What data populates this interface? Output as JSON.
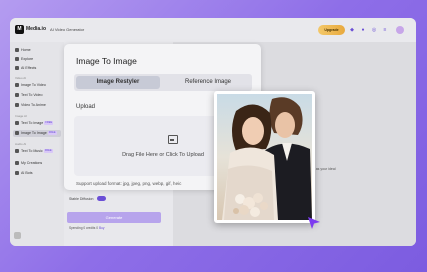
{
  "topbar": {
    "brand": "Media.io",
    "title": "AI Video Generator",
    "upgrade_label": "Upgrade"
  },
  "sidebar": {
    "items": [
      {
        "label": "Home"
      },
      {
        "label": "Explore"
      },
      {
        "label": "AI Effects"
      }
    ],
    "section_video": "Video AI",
    "video_items": [
      {
        "label": "Image To Video"
      },
      {
        "label": "Text To Video"
      },
      {
        "label": "Video To Anime"
      }
    ],
    "section_image": "Image AI",
    "image_items": [
      {
        "label": "Text To Image",
        "tag": "FREE"
      },
      {
        "label": "Image To Image",
        "tag": "FREE"
      }
    ],
    "section_audio": "Audio AI",
    "audio_items": [
      {
        "label": "Text To Music",
        "tag": "FREE"
      }
    ],
    "bottom_items": [
      {
        "label": "My Creations"
      },
      {
        "label": "AI Bots"
      }
    ]
  },
  "modal": {
    "title": "Image To Image",
    "tabs": [
      "Image Restyler",
      "Reference Image"
    ],
    "active_tab": "Image Restyler",
    "upload_label": "Upload",
    "drop_text": "Drag File Here or Click To Upload",
    "support_text": "Support upload format: jpg, jpeg, png, webp, gif, heic"
  },
  "left_panel": {
    "stability_label": "Stable Diffusion",
    "generate_label": "Generate",
    "credits_text": "Spending 0 credits 0",
    "credits_link": "Buy"
  },
  "workspace": {
    "hint": "Edit it as your ideal"
  },
  "colors": {
    "accent": "#6b4fd6",
    "background_gradient": [
      "#b49cf0",
      "#7c5ce0"
    ]
  }
}
